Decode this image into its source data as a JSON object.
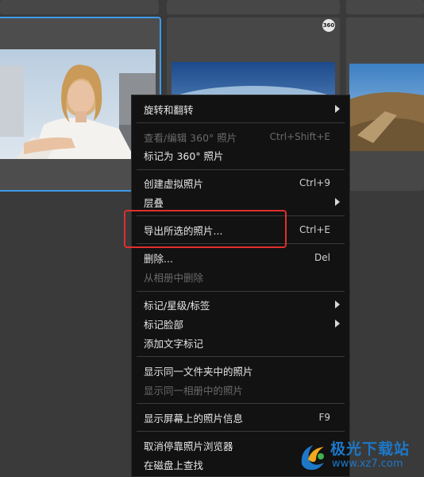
{
  "thumbnails": {
    "badge_360": "360"
  },
  "menu": {
    "items": [
      {
        "label": "旋转和翻转",
        "shortcut": "",
        "submenu": true,
        "disabled": false
      },
      {
        "label": "查看/编辑 360° 照片",
        "shortcut": "Ctrl+Shift+E",
        "submenu": false,
        "disabled": true
      },
      {
        "label": "标记为 360° 照片",
        "shortcut": "",
        "submenu": false,
        "disabled": false
      },
      {
        "label": "创建虚拟照片",
        "shortcut": "Ctrl+9",
        "submenu": false,
        "disabled": false
      },
      {
        "label": "层叠",
        "shortcut": "",
        "submenu": true,
        "disabled": false
      },
      {
        "label": "导出所选的照片...",
        "shortcut": "Ctrl+E",
        "submenu": false,
        "disabled": false
      },
      {
        "label": "删除...",
        "shortcut": "Del",
        "submenu": false,
        "disabled": false
      },
      {
        "label": "从相册中删除",
        "shortcut": "",
        "submenu": false,
        "disabled": true
      },
      {
        "label": "标记/星级/标签",
        "shortcut": "",
        "submenu": true,
        "disabled": false
      },
      {
        "label": "标记脸部",
        "shortcut": "",
        "submenu": true,
        "disabled": false
      },
      {
        "label": "添加文字标记",
        "shortcut": "",
        "submenu": false,
        "disabled": false
      },
      {
        "label": "显示同一文件夹中的照片",
        "shortcut": "",
        "submenu": false,
        "disabled": false
      },
      {
        "label": "显示同一相册中的照片",
        "shortcut": "",
        "submenu": false,
        "disabled": true
      },
      {
        "label": "显示屏幕上的照片信息",
        "shortcut": "F9",
        "submenu": false,
        "disabled": false
      },
      {
        "label": "取消停靠照片浏览器",
        "shortcut": "",
        "submenu": false,
        "disabled": false
      },
      {
        "label": "在磁盘上查找",
        "shortcut": "",
        "submenu": false,
        "disabled": false
      }
    ]
  },
  "watermark": {
    "name": "极光下载站",
    "url": "www.xz7.com"
  },
  "colors": {
    "selection_border": "#3d9be9",
    "annotation_box": "#e0302c",
    "menu_background": "#121212"
  }
}
